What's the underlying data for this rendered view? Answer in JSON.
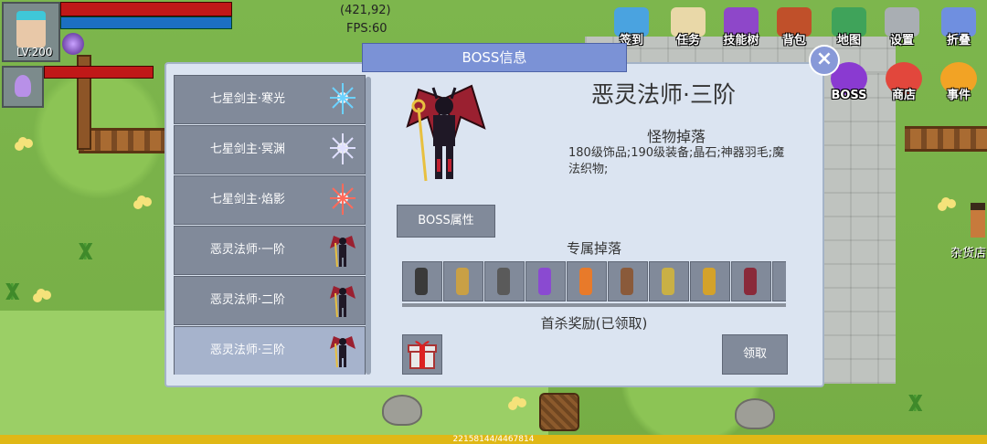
{
  "hud": {
    "level": "LV:200",
    "coords": "(421,92)",
    "fps": "FPS:60",
    "exp": "22158144/4467814",
    "exp_fraction": 1.0
  },
  "top_menu": [
    {
      "label": "签到",
      "icon": "calendar-icon",
      "color": "#4aa3e0"
    },
    {
      "label": "任务",
      "icon": "scroll-icon",
      "color": "#e9d8a8"
    },
    {
      "label": "技能树",
      "icon": "skill-book-icon",
      "color": "#8e47c9"
    },
    {
      "label": "背包",
      "icon": "backpack-icon",
      "color": "#c0502a"
    },
    {
      "label": "地图",
      "icon": "map-icon",
      "color": "#3fa35a"
    },
    {
      "label": "设置",
      "icon": "gear-icon",
      "color": "#a9aeb3"
    },
    {
      "label": "折叠",
      "icon": "collapse-icon",
      "color": "#6f8fe0"
    }
  ],
  "side_menu": [
    {
      "label": "BOSS",
      "icon": "boss-icon",
      "color": "#8a3ad1"
    },
    {
      "label": "商店",
      "icon": "shop-icon",
      "color": "#e2473c"
    },
    {
      "label": "事件",
      "icon": "event-icon",
      "color": "#f2a325"
    }
  ],
  "npc_label": "杂货店",
  "dialog": {
    "title": "BOSS信息",
    "boss_list": [
      {
        "name": "七星剑主·寒光",
        "selected": false
      },
      {
        "name": "七星剑主·冥渊",
        "selected": false
      },
      {
        "name": "七星剑主·焰影",
        "selected": false
      },
      {
        "name": "恶灵法师·一阶",
        "selected": false
      },
      {
        "name": "恶灵法师·二阶",
        "selected": false
      },
      {
        "name": "恶灵法师·三阶",
        "selected": true
      }
    ],
    "boss_name": "恶灵法师·三阶",
    "drops_title": "怪物掉落",
    "drops_text": "180级饰品;190级装备;晶石;神器羽毛;魔法织物;",
    "attr_button": "BOSS属性",
    "exclusive_title": "专属掉落",
    "exclusive_items": [
      {
        "icon": "staff-icon",
        "color": "#3a3a3a"
      },
      {
        "icon": "bow-icon",
        "color": "#c9a045"
      },
      {
        "icon": "shield-icon",
        "color": "#5a5a5a"
      },
      {
        "icon": "dagger-icon",
        "color": "#8a4ad1"
      },
      {
        "icon": "flame-sword-icon",
        "color": "#e87a2a"
      },
      {
        "icon": "club-icon",
        "color": "#8a5a3a"
      },
      {
        "icon": "wand-icon",
        "color": "#c9b045"
      },
      {
        "icon": "golden-bow-icon",
        "color": "#d4a22a"
      },
      {
        "icon": "armor-icon",
        "color": "#8a2a3a"
      },
      {
        "icon": "extra-item-icon",
        "color": "#818a9a"
      }
    ],
    "first_kill_title": "首杀奖励(已领取)",
    "reward_icon": "gift-box-icon",
    "claim_button": "领取"
  }
}
